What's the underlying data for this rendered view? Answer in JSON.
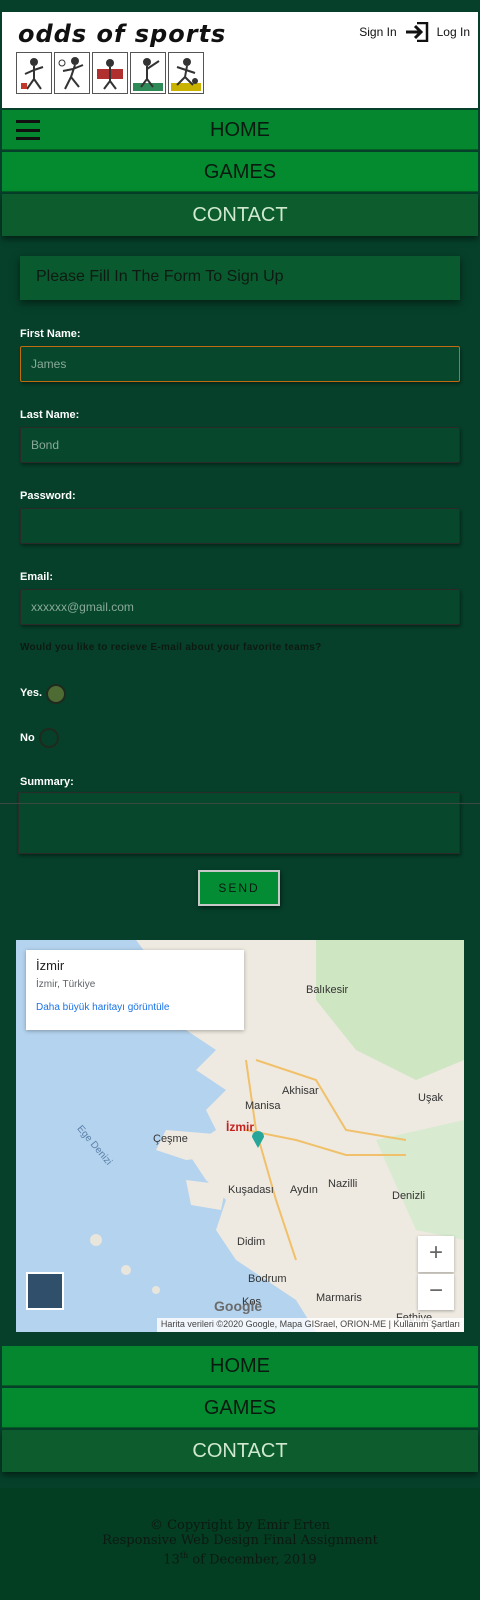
{
  "header": {
    "logo_text": "odds of sports",
    "sign_in": "Sign In",
    "log_in": "Log In"
  },
  "nav": {
    "home": "HOME",
    "games": "GAMES",
    "contact": "CONTACT"
  },
  "form": {
    "title": "Please Fill In The Form To Sign Up",
    "first_name_label": "First Name:",
    "first_name_placeholder": "James",
    "last_name_label": "Last Name:",
    "last_name_placeholder": "Bond",
    "password_label": "Password:",
    "email_label": "Email:",
    "email_placeholder": "xxxxxx@gmail.com",
    "question": "Would you like to recieve E-mail about your favorite teams?",
    "yes_label": "Yes.",
    "no_label": "No",
    "summary_label": "Summary:",
    "send_label": "SEND"
  },
  "map": {
    "place": "İzmir",
    "sub": "İzmir, Türkiye",
    "link": "Daha büyük haritayı görüntüle",
    "cities": {
      "balikesir": "Balıkesir",
      "akhisar": "Akhisar",
      "manisa": "Manisa",
      "usak": "Uşak",
      "izmir": "İzmir",
      "cesme": "Çeşme",
      "kusadasi": "Kuşadası",
      "aydin": "Aydın",
      "nazilli": "Nazilli",
      "denizli": "Denizli",
      "didim": "Didim",
      "bodrum": "Bodrum",
      "marmaris": "Marmaris",
      "kos": "Kos",
      "fethiye": "Fethiye",
      "ege": "Ege Denizi"
    },
    "zoom_in": "+",
    "zoom_out": "−",
    "google": "Google",
    "attribution": "Harita verileri ©2020 Google, Mapa GISrael, ORION-ME  |  Kullanım Şartları"
  },
  "footer": {
    "copyright": "© Copyright by Emir Erten",
    "assignment": "Responsive Web Design Final Assignment",
    "date_day": "13",
    "date_suffix": "th",
    "date_rest": " of December, 2019"
  }
}
